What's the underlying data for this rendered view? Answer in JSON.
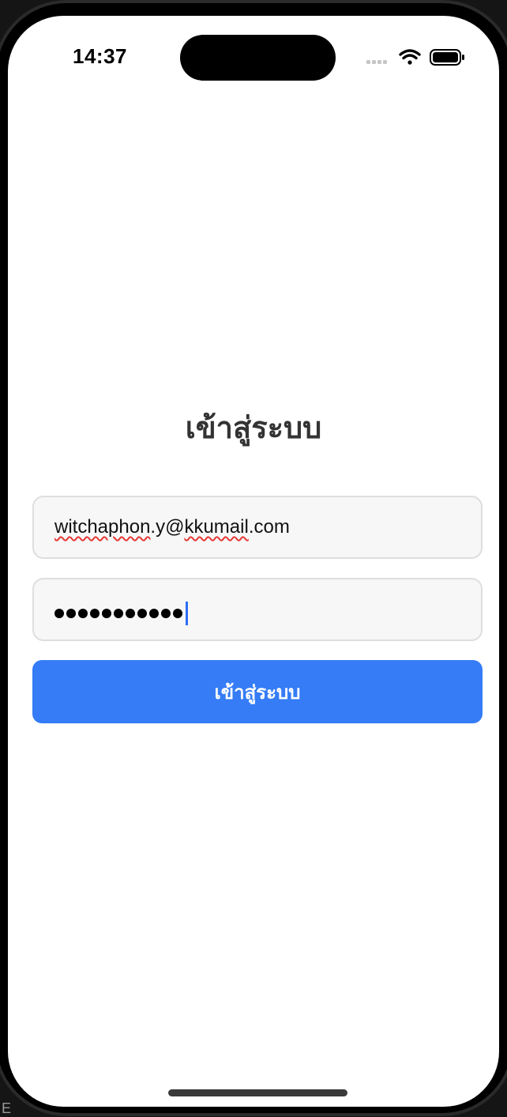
{
  "status_bar": {
    "time": "14:37",
    "icons": [
      "signal-icon",
      "wifi-icon",
      "battery-icon"
    ]
  },
  "login": {
    "title": "เข้าสู่ระบบ",
    "email_value": "witchaphon.y@kkumail.com",
    "email_user_part": "witchaphon",
    "email_middle": ".y@",
    "email_domain_part": "kkumail",
    "email_tld": ".com",
    "password_length": 11,
    "submit_label": "เข้าสู่ระบบ"
  },
  "colors": {
    "button": "#357cf6",
    "title": "#333333",
    "field_bg": "#f7f7f7",
    "caret": "#2d6cf5"
  },
  "desktop_edge": {
    "corner_glyph": "E"
  }
}
